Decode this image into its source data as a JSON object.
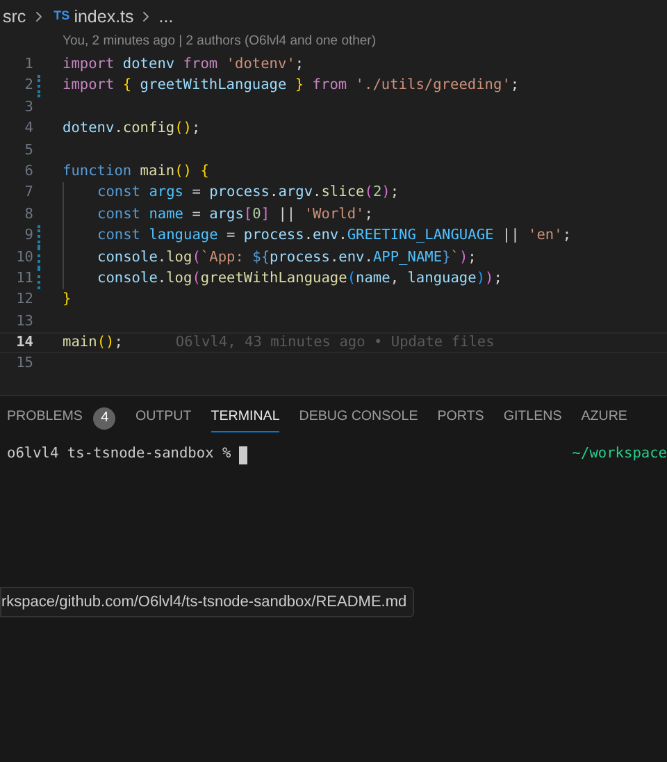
{
  "breadcrumb": {
    "folder": "src",
    "file_badge": "TS",
    "file": "index.ts",
    "more": "..."
  },
  "blame_header": "You, 2 minutes ago | 2 authors (O6lvl4 and one other)",
  "lines": [
    {
      "number": "1",
      "modified": false,
      "current": false,
      "indented": false,
      "tokens": [
        {
          "kind": "keyword",
          "text": "import"
        },
        {
          "kind": "variable",
          "text": " dotenv"
        },
        {
          "kind": "keyword",
          "text": " from"
        },
        {
          "kind": "string",
          "text": " 'dotenv'"
        },
        {
          "kind": "plain",
          "text": ";"
        }
      ]
    },
    {
      "number": "2",
      "modified": true,
      "current": false,
      "indented": false,
      "tokens": [
        {
          "kind": "keyword",
          "text": "import"
        },
        {
          "kind": "bracket1",
          "text": " {"
        },
        {
          "kind": "variable",
          "text": " greetWithLanguage"
        },
        {
          "kind": "bracket1",
          "text": " }"
        },
        {
          "kind": "keyword",
          "text": " from"
        },
        {
          "kind": "string",
          "text": " './utils/greeding'"
        },
        {
          "kind": "plain",
          "text": ";"
        }
      ]
    },
    {
      "number": "3",
      "modified": false,
      "current": false,
      "indented": false
    },
    {
      "number": "4",
      "modified": false,
      "current": false,
      "indented": false,
      "tokens": [
        {
          "kind": "variable",
          "text": "dotenv"
        },
        {
          "kind": "plain",
          "text": "."
        },
        {
          "kind": "function",
          "text": "config"
        },
        {
          "kind": "bracket1",
          "text": "()"
        },
        {
          "kind": "plain",
          "text": ";"
        }
      ]
    },
    {
      "number": "5",
      "modified": false,
      "current": false,
      "indented": false
    },
    {
      "number": "6",
      "modified": false,
      "current": false,
      "indented": false,
      "tokens": [
        {
          "kind": "storage",
          "text": "function"
        },
        {
          "kind": "function",
          "text": " main"
        },
        {
          "kind": "bracket1",
          "text": "()"
        },
        {
          "kind": "bracket1",
          "text": " {"
        }
      ]
    },
    {
      "number": "7",
      "modified": false,
      "current": false,
      "indented": true,
      "tokens": [
        {
          "kind": "storage",
          "text": "const"
        },
        {
          "kind": "constant",
          "text": " args"
        },
        {
          "kind": "plain",
          "text": " = "
        },
        {
          "kind": "variable",
          "text": "process"
        },
        {
          "kind": "plain",
          "text": "."
        },
        {
          "kind": "variable",
          "text": "argv"
        },
        {
          "kind": "plain",
          "text": "."
        },
        {
          "kind": "function",
          "text": "slice"
        },
        {
          "kind": "bracket2",
          "text": "("
        },
        {
          "kind": "number",
          "text": "2"
        },
        {
          "kind": "bracket2",
          "text": ")"
        },
        {
          "kind": "plain",
          "text": ";"
        }
      ]
    },
    {
      "number": "8",
      "modified": false,
      "current": false,
      "indented": true,
      "tokens": [
        {
          "kind": "storage",
          "text": "const"
        },
        {
          "kind": "constant",
          "text": " name"
        },
        {
          "kind": "plain",
          "text": " = "
        },
        {
          "kind": "variable",
          "text": "args"
        },
        {
          "kind": "bracket2",
          "text": "["
        },
        {
          "kind": "number",
          "text": "0"
        },
        {
          "kind": "bracket2",
          "text": "]"
        },
        {
          "kind": "plain",
          "text": " || "
        },
        {
          "kind": "string",
          "text": "'World'"
        },
        {
          "kind": "plain",
          "text": ";"
        }
      ]
    },
    {
      "number": "9",
      "modified": true,
      "current": false,
      "indented": true,
      "tokens": [
        {
          "kind": "storage",
          "text": "const"
        },
        {
          "kind": "constant",
          "text": " language"
        },
        {
          "kind": "plain",
          "text": " = "
        },
        {
          "kind": "variable",
          "text": "process"
        },
        {
          "kind": "plain",
          "text": "."
        },
        {
          "kind": "variable",
          "text": "env"
        },
        {
          "kind": "plain",
          "text": "."
        },
        {
          "kind": "constant",
          "text": "GREETING_LANGUAGE"
        },
        {
          "kind": "plain",
          "text": " || "
        },
        {
          "kind": "string",
          "text": "'en'"
        },
        {
          "kind": "plain",
          "text": ";"
        }
      ]
    },
    {
      "number": "10",
      "modified": true,
      "current": false,
      "indented": true,
      "tokens": [
        {
          "kind": "variable",
          "text": "console"
        },
        {
          "kind": "plain",
          "text": "."
        },
        {
          "kind": "function",
          "text": "log"
        },
        {
          "kind": "bracket2",
          "text": "("
        },
        {
          "kind": "string",
          "text": "`App: "
        },
        {
          "kind": "interpolation",
          "text": "${"
        },
        {
          "kind": "variable",
          "text": "process"
        },
        {
          "kind": "plain",
          "text": "."
        },
        {
          "kind": "variable",
          "text": "env"
        },
        {
          "kind": "plain",
          "text": "."
        },
        {
          "kind": "constant",
          "text": "APP_NAME"
        },
        {
          "kind": "interpolation",
          "text": "}"
        },
        {
          "kind": "string",
          "text": "`"
        },
        {
          "kind": "bracket2",
          "text": ")"
        },
        {
          "kind": "plain",
          "text": ";"
        }
      ]
    },
    {
      "number": "11",
      "modified": true,
      "current": false,
      "indented": true,
      "tokens": [
        {
          "kind": "variable",
          "text": "console"
        },
        {
          "kind": "plain",
          "text": "."
        },
        {
          "kind": "function",
          "text": "log"
        },
        {
          "kind": "bracket2",
          "text": "("
        },
        {
          "kind": "function",
          "text": "greetWithLanguage"
        },
        {
          "kind": "bracket3",
          "text": "("
        },
        {
          "kind": "variable",
          "text": "name"
        },
        {
          "kind": "plain",
          "text": ","
        },
        {
          "kind": "variable",
          "text": " language"
        },
        {
          "kind": "bracket3",
          "text": ")"
        },
        {
          "kind": "bracket2",
          "text": ")"
        },
        {
          "kind": "plain",
          "text": ";"
        }
      ]
    },
    {
      "number": "12",
      "modified": false,
      "current": false,
      "indented": false,
      "tokens": [
        {
          "kind": "bracket1",
          "text": "}"
        }
      ]
    },
    {
      "number": "13",
      "modified": false,
      "current": false,
      "indented": false
    },
    {
      "number": "14",
      "modified": false,
      "current": true,
      "indented": false,
      "annotation": "O6lvl4, 43 minutes ago • Update files",
      "tokens": [
        {
          "kind": "function",
          "text": "main"
        },
        {
          "kind": "bracket1",
          "text": "()"
        },
        {
          "kind": "plain",
          "text": ";"
        }
      ]
    },
    {
      "number": "15",
      "modified": false,
      "current": false,
      "indented": false
    }
  ],
  "panel_tabs": [
    {
      "label": "PROBLEMS",
      "badge": "4",
      "selected": false
    },
    {
      "label": "OUTPUT",
      "selected": false
    },
    {
      "label": "TERMINAL",
      "selected": true
    },
    {
      "label": "DEBUG CONSOLE",
      "selected": false
    },
    {
      "label": "PORTS",
      "selected": false
    },
    {
      "label": "GITLENS",
      "selected": false
    },
    {
      "label": "AZURE",
      "selected": false
    }
  ],
  "terminal": {
    "prompt": "o6lvl4 ts-tsnode-sandbox %",
    "cwd": "~/workspace"
  },
  "tooltip": "rkspace/github.com/O6lvl4/ts-tsnode-sandbox/README.md"
}
